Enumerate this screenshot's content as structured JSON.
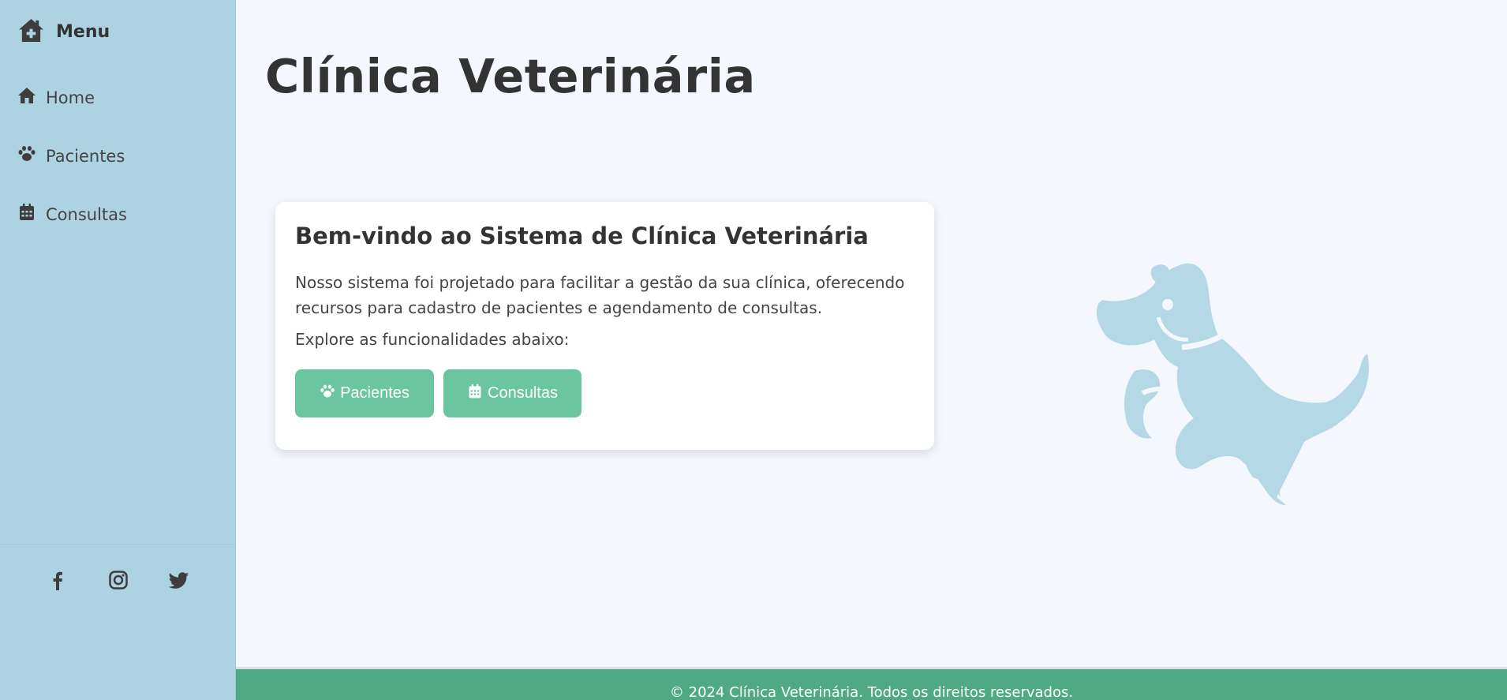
{
  "sidebar": {
    "title": "Menu",
    "items": [
      {
        "label": "Home",
        "icon": "home-icon"
      },
      {
        "label": "Pacientes",
        "icon": "paw-icon"
      },
      {
        "label": "Consultas",
        "icon": "calendar-icon"
      }
    ],
    "social": [
      "facebook-icon",
      "instagram-icon",
      "twitter-icon"
    ]
  },
  "main": {
    "title": "Clínica Veterinária",
    "card": {
      "title": "Bem-vindo ao Sistema de Clínica Veterinária",
      "text": "Nosso sistema foi projetado para facilitar a gestão da sua clínica, oferecendo recursos para cadastro de pacientes e agendamento de consultas.",
      "subtext": "Explore as funcionalidades abaixo:",
      "buttons": [
        {
          "label": "Pacientes",
          "icon": "paw-icon"
        },
        {
          "label": "Consultas",
          "icon": "calendar-icon"
        }
      ]
    }
  },
  "footer": {
    "text": "© 2024 Clínica Veterinária. Todos os direitos reservados."
  },
  "colors": {
    "sidebar_bg": "#add3e3",
    "page_bg": "#f4f7fd",
    "button_bg": "#6bc5a0",
    "footer_bg": "#4fa985",
    "dog_color": "#b5d8e6"
  }
}
